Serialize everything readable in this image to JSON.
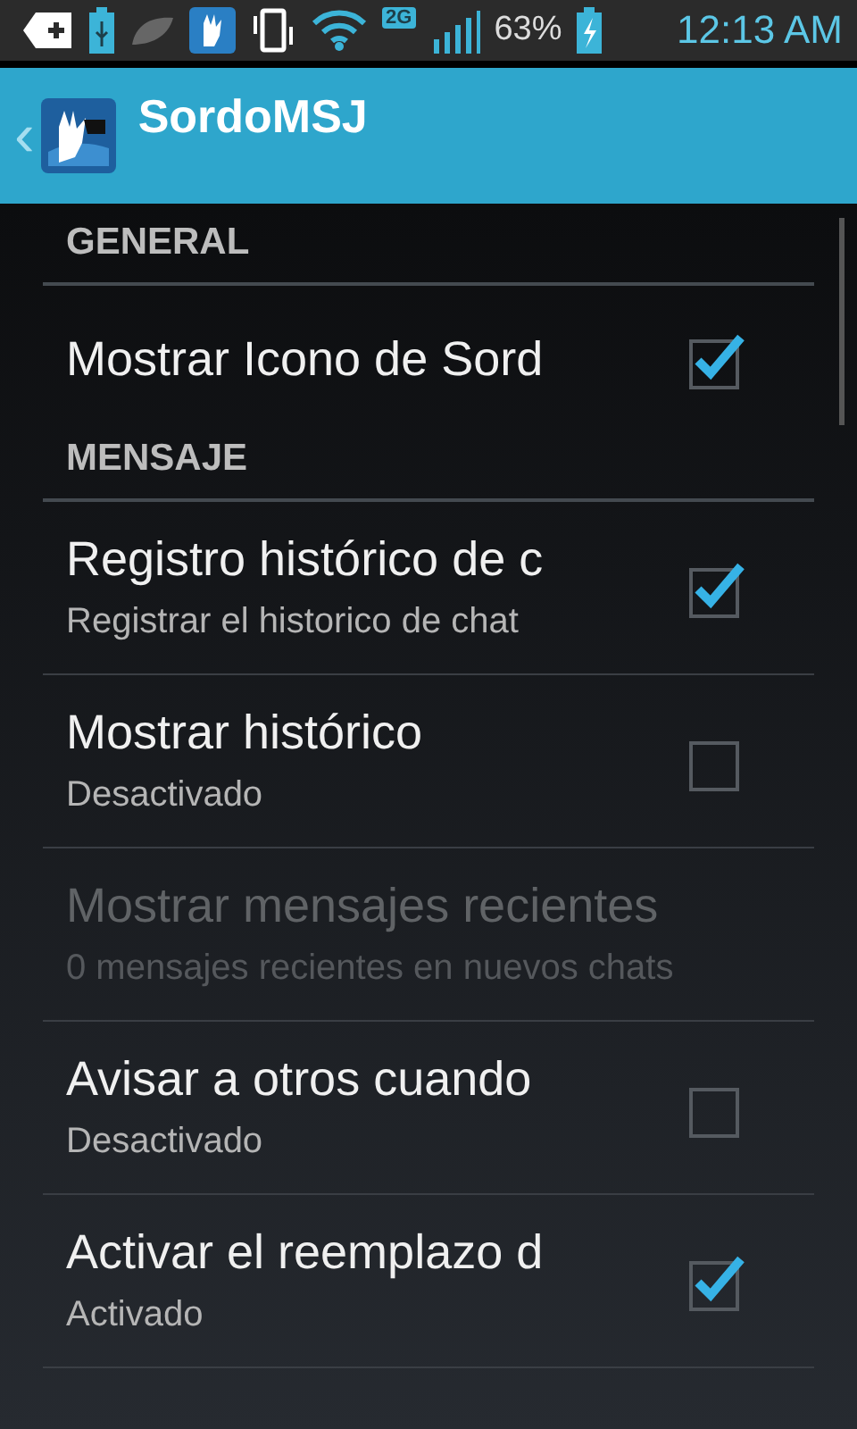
{
  "status_bar": {
    "network_badge": "2G",
    "battery": "63%",
    "time": "12:13 AM"
  },
  "action_bar": {
    "back": "‹",
    "title": "SordoMSJ"
  },
  "preferences": [
    {
      "kind": "header",
      "title": "GENERAL"
    },
    {
      "kind": "checkbox",
      "title": "Mostrar Icono de Sord",
      "checked": true,
      "disabled": false
    },
    {
      "kind": "header",
      "title": "MENSAJE"
    },
    {
      "kind": "checkbox",
      "title": "Registro histórico de c",
      "summary": "Registrar el historico de chat",
      "checked": true,
      "disabled": false
    },
    {
      "kind": "checkbox",
      "title": "Mostrar histórico",
      "summary": "Desactivado",
      "checked": false,
      "disabled": false
    },
    {
      "kind": "plain",
      "title": "Mostrar mensajes recientes",
      "summary": "0 mensajes recientes en nuevos chats",
      "disabled": true
    },
    {
      "kind": "checkbox",
      "title": "Avisar a otros cuando",
      "summary": "Desactivado",
      "checked": false,
      "disabled": false
    },
    {
      "kind": "checkbox",
      "title": "Activar el reemplazo d",
      "summary": "Activado",
      "checked": true,
      "disabled": false
    }
  ]
}
